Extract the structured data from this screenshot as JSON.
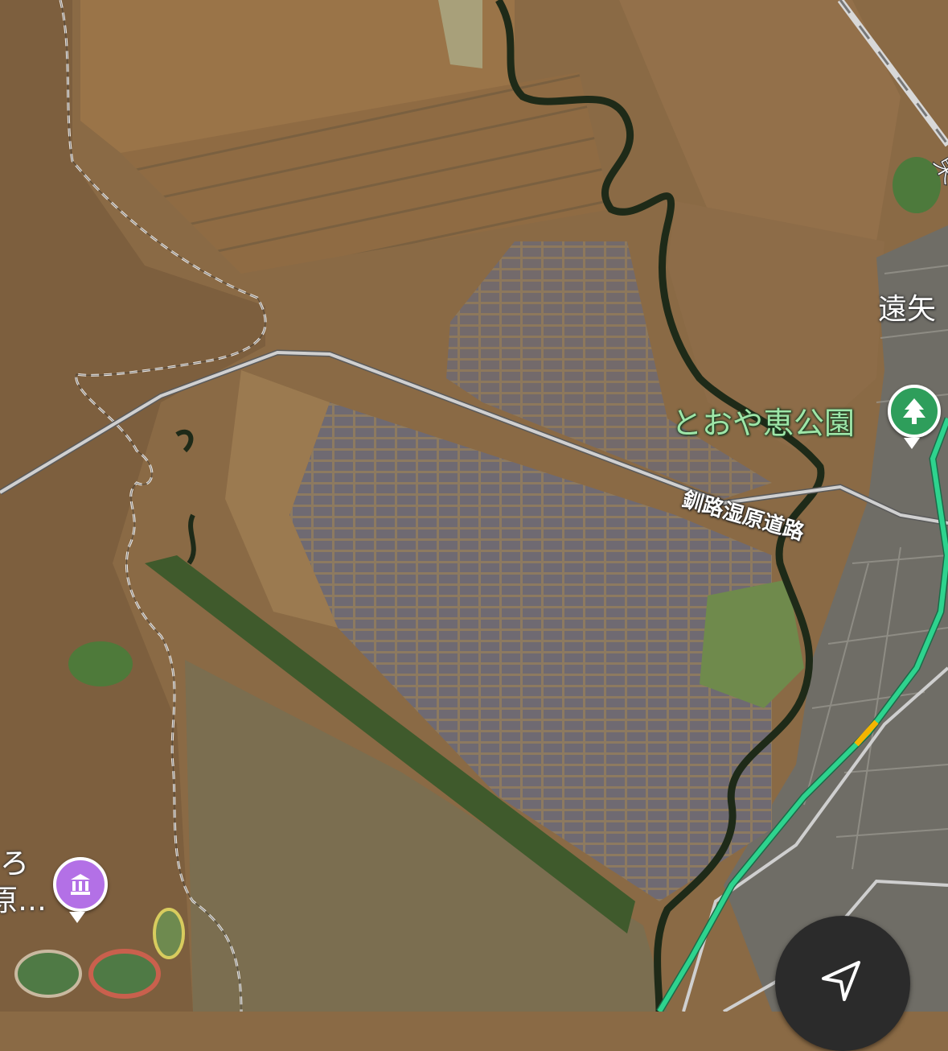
{
  "map": {
    "view": "satellite",
    "colors": {
      "terrain": "#8a6a45",
      "river": "#1e2a18",
      "road": "#d0d0d0",
      "route": "#2ed38e",
      "route_warning": "#f4b400",
      "park_pin": "#2e9e5b",
      "museum_pin": "#b370e6"
    }
  },
  "labels": {
    "road_name": "釧路湿原道路",
    "park_name": "とおや恵公園",
    "town_name": "遠矢",
    "poi_name_line1": "ろ",
    "poi_name_line2": "原…",
    "edge_glyph": "東"
  },
  "icons": {
    "park": "tree-icon",
    "museum": "museum-icon",
    "locate": "navigation-arrow-icon"
  }
}
